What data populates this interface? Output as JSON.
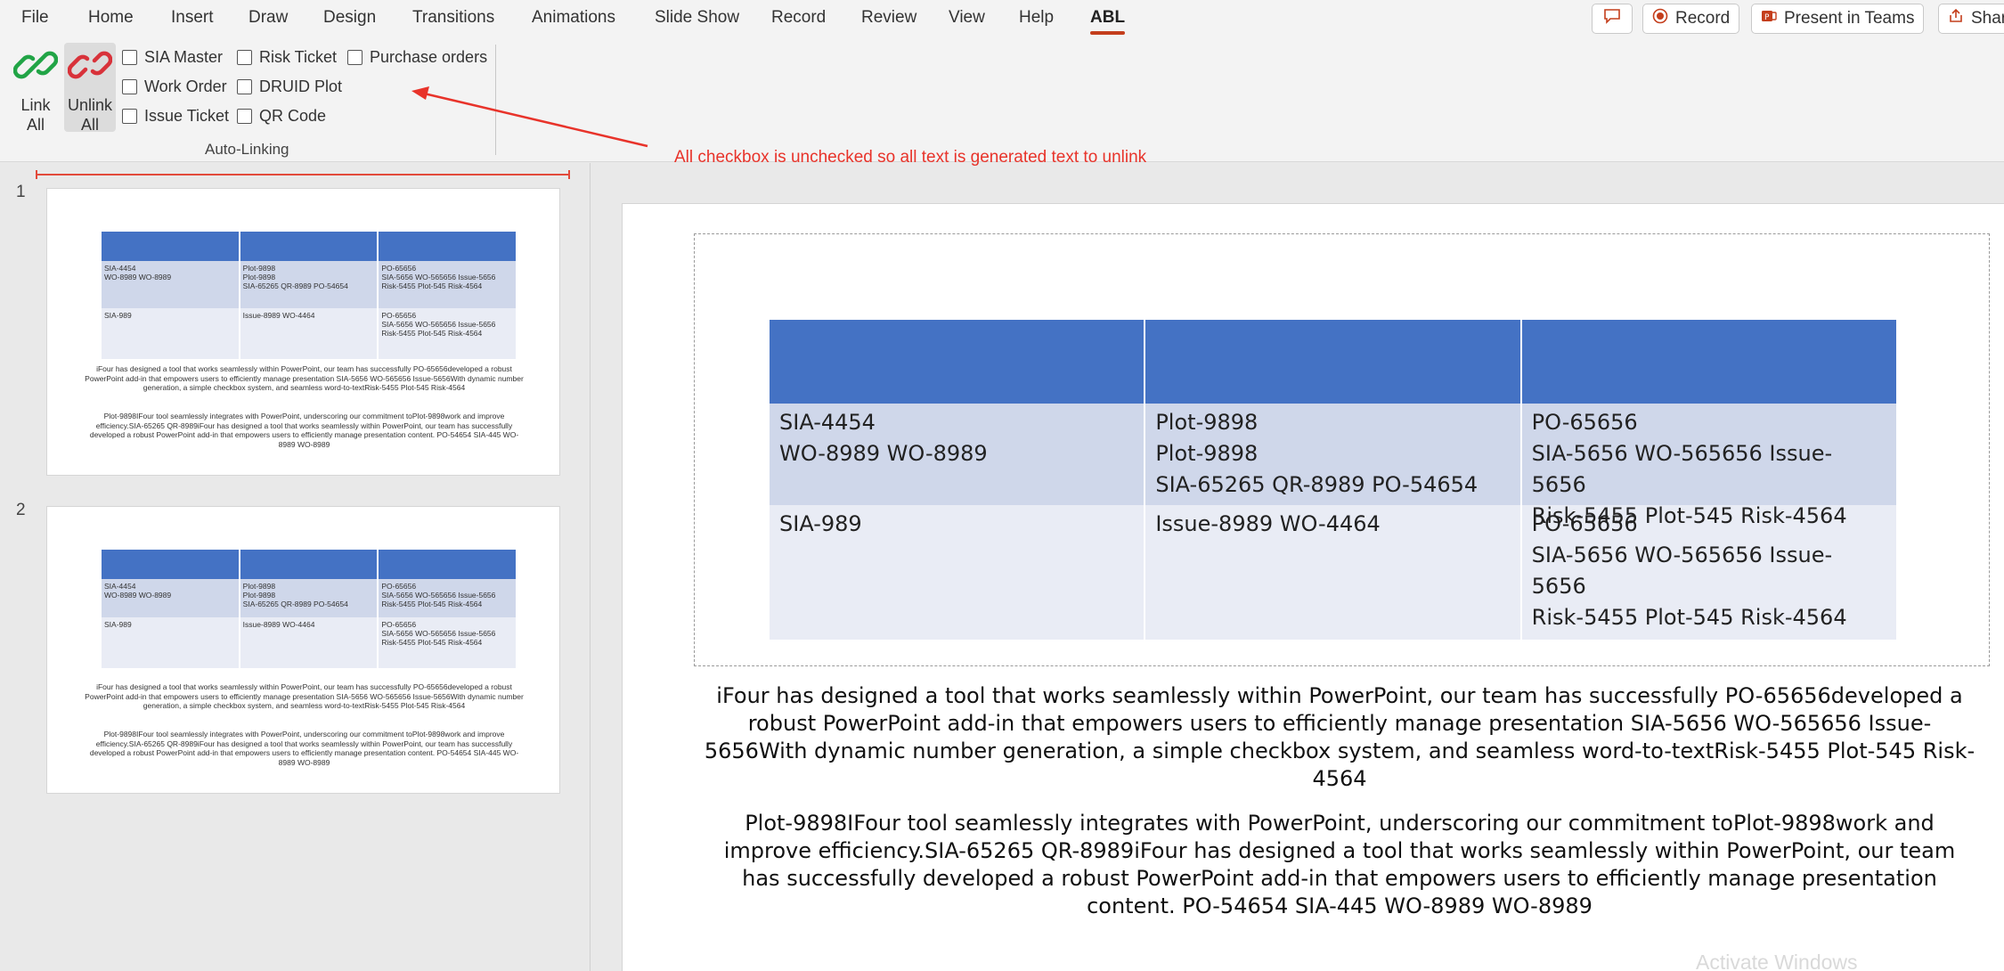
{
  "menu": {
    "tabs": [
      "File",
      "Home",
      "Insert",
      "Draw",
      "Design",
      "Transitions",
      "Animations",
      "Slide Show",
      "Record",
      "Review",
      "View",
      "Help",
      "ABL"
    ],
    "active_tab": "ABL"
  },
  "top_actions": {
    "record_label": "Record",
    "present_label": "Present in Teams",
    "share_label": "Share"
  },
  "ribbon": {
    "link_all_label": "Link All",
    "unlink_all_label": "Unlink All",
    "checkboxes": [
      "SIA Master",
      "Work Order",
      "Issue Ticket",
      "Risk Ticket",
      "DRUID Plot",
      "QR Code",
      "Purchase orders"
    ],
    "group_label": "Auto-Linking"
  },
  "annotation": {
    "text": "All checkbox is unchecked so all text is generated text to unlink",
    "color": "#e8332a"
  },
  "slides": {
    "numbers": [
      "1",
      "2"
    ]
  },
  "table": {
    "rows": [
      [
        "SIA-4454\nWO-8989 WO-8989",
        "Plot-9898\nPlot-9898\nSIA-65265  QR-8989 PO-54654",
        "PO-65656\nSIA-5656 WO-565656 Issue-5656\nRisk-5455 Plot-545 Risk-4564"
      ],
      [
        "SIA-989",
        "Issue-8989 WO-4464",
        "PO-65656\nSIA-5656 WO-565656 Issue-5656\nRisk-5455 Plot-545 Risk-4564"
      ]
    ],
    "header_color": "#4472c4"
  },
  "paragraphs": {
    "p1": "iFour has designed a tool that works seamlessly within PowerPoint, our team has successfully  PO-65656developed a robust PowerPoint add-in that empowers users to efficiently manage presentation SIA-5656 WO-565656 Issue-5656With dynamic number generation, a simple checkbox system, and seamless word-to-textRisk-5455 Plot-545 Risk-4564",
    "p2": "Plot-9898IFour tool seamlessly integrates with PowerPoint, underscoring our commitment toPlot-9898work and improve efficiency.SIA-65265  QR-8989iFour has designed a tool that works seamlessly within PowerPoint, our team has successfully developed a robust PowerPoint add-in that empowers users to efficiently manage presentation content. PO-54654 SIA-445 WO-8989 WO-8989"
  },
  "watermark": "Activate Windows"
}
